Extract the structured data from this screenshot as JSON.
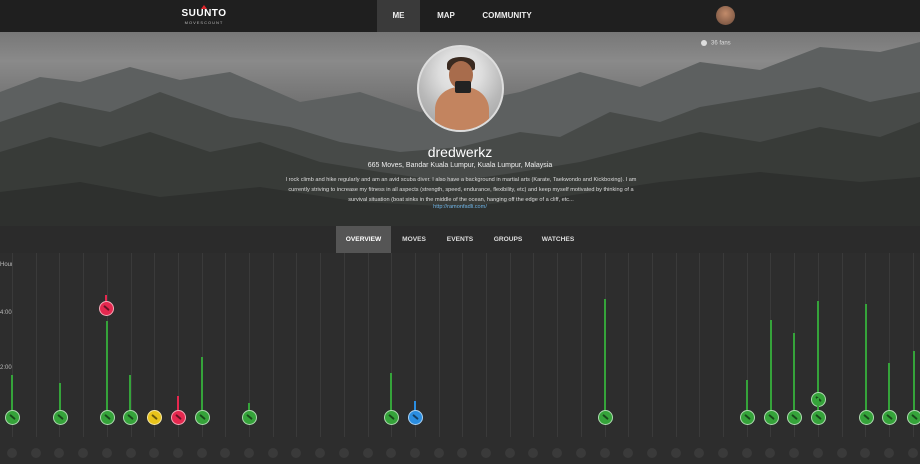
{
  "brand": {
    "name": "SUUNTO",
    "sub": "MOVESCOUNT"
  },
  "nav": [
    {
      "label": "ME",
      "active": true
    },
    {
      "label": "MAP",
      "active": false
    },
    {
      "label": "COMMUNITY",
      "active": false
    }
  ],
  "profile": {
    "fans": "36 fans",
    "username": "dredwerkz",
    "meta": "665 Moves, Bandar Kuala Lumpur, Kuala Lumpur, Malaysia",
    "bio": "I rock climb and hike regularly and am an avid scuba diver. I also have a background in martial arts (Karate, Taekwondo and Kickboxing). I am currently striving to increase my fitness in all aspects (strength, speed, endurance, flexibility, etc) and keep myself motivated by thinking of a survival situation (boat sinks in the middle of the ocean, hanging off the edge of a cliff, etc...",
    "link": "http://ramonfadli.com/"
  },
  "tabs": [
    {
      "label": "OVERVIEW",
      "active": true
    },
    {
      "label": "MOVES",
      "active": false
    },
    {
      "label": "EVENTS",
      "active": false
    },
    {
      "label": "GROUPS",
      "active": false
    },
    {
      "label": "WATCHES",
      "active": false
    }
  ],
  "timeline": {
    "y_labels": [
      "Hour",
      "4:00",
      "2:00"
    ],
    "colors": {
      "green": "#35a33a",
      "red": "#e5284f",
      "yellow": "#e8c31a",
      "blue": "#2a8de0"
    }
  }
}
